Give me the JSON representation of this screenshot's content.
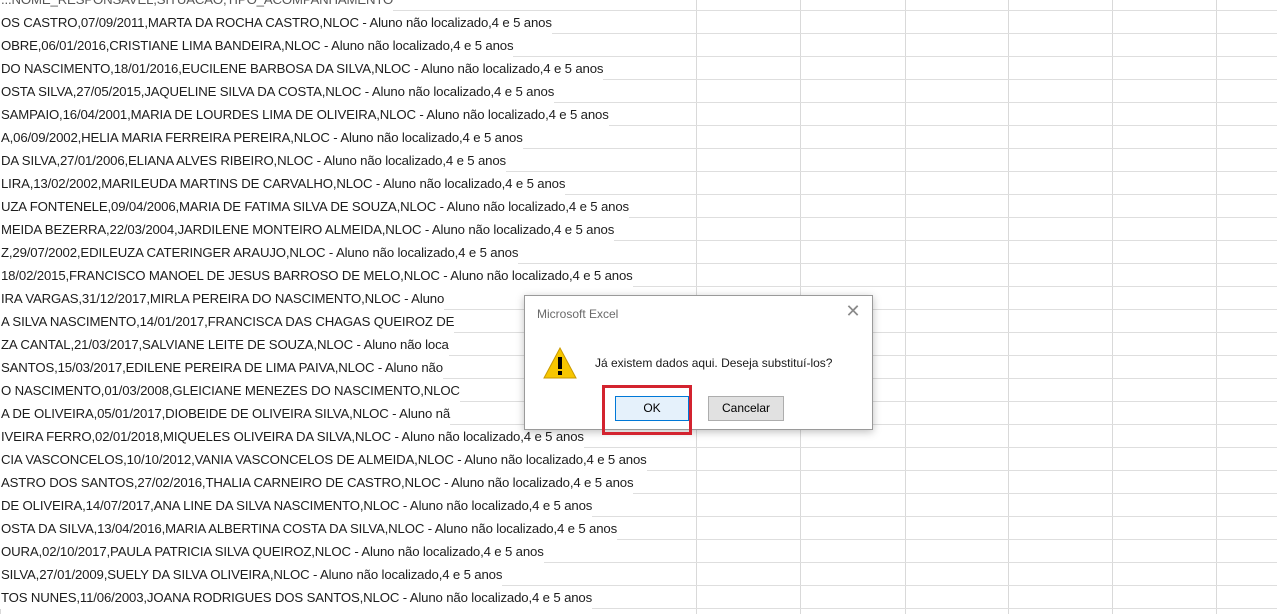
{
  "spreadsheet": {
    "header_fragment": "...NOME_RESPONSAVEL,SITUACAO,TIPO_ACOMPANHAMENTO",
    "rows": [
      "OS CASTRO,07/09/2011,MARTA DA ROCHA CASTRO,NLOC - Aluno não localizado,4 e 5 anos",
      "OBRE,06/01/2016,CRISTIANE LIMA BANDEIRA,NLOC - Aluno não localizado,4 e 5 anos",
      "DO NASCIMENTO,18/01/2016,EUCILENE BARBOSA DA SILVA,NLOC - Aluno não localizado,4 e 5 anos",
      "OSTA SILVA,27/05/2015,JAQUELINE SILVA DA COSTA,NLOC - Aluno não localizado,4 e 5 anos",
      "SAMPAIO,16/04/2001,MARIA DE LOURDES LIMA DE OLIVEIRA,NLOC - Aluno não localizado,4 e 5 anos",
      "A,06/09/2002,HELIA MARIA FERREIRA PEREIRA,NLOC - Aluno não localizado,4 e 5 anos",
      "DA SILVA,27/01/2006,ELIANA ALVES RIBEIRO,NLOC - Aluno não localizado,4 e 5 anos",
      "LIRA,13/02/2002,MARILEUDA MARTINS DE CARVALHO,NLOC - Aluno não localizado,4 e 5 anos",
      "UZA FONTENELE,09/04/2006,MARIA DE FATIMA SILVA DE SOUZA,NLOC - Aluno não localizado,4 e 5 anos",
      "MEIDA BEZERRA,22/03/2004,JARDILENE MONTEIRO ALMEIDA,NLOC - Aluno não localizado,4 e 5 anos",
      "Z,29/07/2002,EDILEUZA CATERINGER ARAUJO,NLOC - Aluno não localizado,4 e 5 anos",
      "18/02/2015,FRANCISCO MANOEL DE JESUS BARROSO DE MELO,NLOC - Aluno não localizado,4 e 5 anos",
      "IRA VARGAS,31/12/2017,MIRLA PEREIRA DO NASCIMENTO,NLOC - Aluno",
      "A SILVA NASCIMENTO,14/01/2017,FRANCISCA DAS CHAGAS QUEIROZ DE",
      "ZA CANTAL,21/03/2017,SALVIANE LEITE DE SOUZA,NLOC - Aluno não loca",
      "SANTOS,15/03/2017,EDILENE PEREIRA DE LIMA PAIVA,NLOC - Aluno não",
      "O NASCIMENTO,01/03/2008,GLEICIANE MENEZES DO NASCIMENTO,NLOC",
      "A DE OLIVEIRA,05/01/2017,DIOBEIDE DE OLIVEIRA SILVA,NLOC - Aluno nã",
      "IVEIRA FERRO,02/01/2018,MIQUELES OLIVEIRA DA SILVA,NLOC - Aluno não localizado,4 e 5 anos",
      "CIA VASCONCELOS,10/10/2012,VANIA VASCONCELOS DE ALMEIDA,NLOC - Aluno não localizado,4 e 5 anos",
      "ASTRO DOS SANTOS,27/02/2016,THALIA CARNEIRO DE CASTRO,NLOC - Aluno não localizado,4 e 5 anos",
      "DE OLIVEIRA,14/07/2017,ANA LINE DA SILVA NASCIMENTO,NLOC - Aluno não localizado,4 e 5 anos",
      "OSTA DA SILVA,13/04/2016,MARIA ALBERTINA COSTA DA SILVA,NLOC - Aluno não localizado,4 e 5 anos",
      "OURA,02/10/2017,PAULA PATRICIA SILVA QUEIROZ,NLOC - Aluno não localizado,4 e 5 anos",
      "SILVA,27/01/2009,SUELY DA SILVA OLIVEIRA,NLOC - Aluno não localizado,4 e 5 anos",
      "TOS NUNES,11/06/2003,JOANA RODRIGUES DOS SANTOS,NLOC - Aluno não localizado,4 e 5 anos"
    ]
  },
  "dialog": {
    "title": "Microsoft Excel",
    "close_glyph": "✕",
    "icon": "warning-icon",
    "message": "Já existem dados aqui. Deseja substituí-los?",
    "ok_label": "OK",
    "cancel_label": "Cancelar"
  },
  "colors": {
    "highlight": "#d3232f",
    "warning": "#f7c600",
    "grid": "#d9d9d9"
  }
}
